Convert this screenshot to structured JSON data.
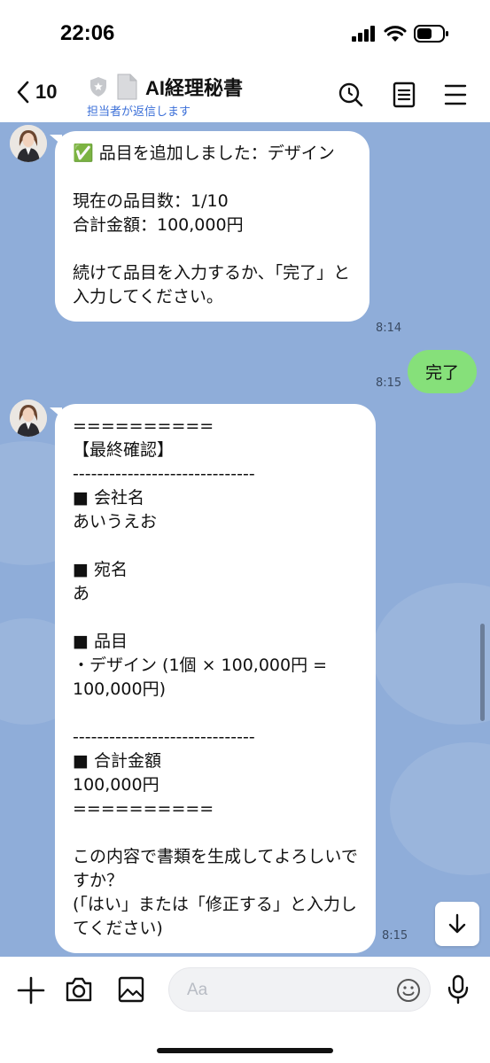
{
  "status_bar": {
    "time": "22:06"
  },
  "header": {
    "back_count": "10",
    "title": "AI経理秘書",
    "subtitle": "担当者が返信します"
  },
  "messages": [
    {
      "sender": "bot",
      "text": "✅ 品目を追加しました：デザイン\n\n現在の品目数：1/10\n合計金額：100,000円\n\n続けて品目を入力するか、「完了」と入力してください。",
      "time": "8:14"
    },
    {
      "sender": "me",
      "text": "完了",
      "time": "8:15"
    },
    {
      "sender": "bot",
      "text": "==========\n【最終確認】\n------------------------------\n■ 会社名\nあいうえお\n\n■ 宛名\nあ\n\n■ 品目\n・デザイン (1個 × 100,000円 = 100,000円)\n\n------------------------------\n■ 合計金額\n100,000円\n==========\n\nこの内容で書類を生成してよろしいですか？\n(「はい」または「修正する」と入力してください)",
      "time": "8:15"
    }
  ],
  "input": {
    "placeholder": "Aa",
    "value": ""
  },
  "icons": {
    "back": "chevron-left-icon",
    "shield": "shield-icon",
    "document": "document-icon",
    "search": "search-icon",
    "notes": "notes-icon",
    "menu": "menu-icon",
    "plus": "plus-icon",
    "camera": "camera-icon",
    "image": "image-icon",
    "emoji": "emoji-icon",
    "mic": "microphone-icon",
    "scroll_down": "arrow-down-icon"
  },
  "colors": {
    "chat_background": "#8fadd9",
    "sent_bubble": "#86e07a",
    "received_bubble": "#ffffff",
    "subtitle_link": "#3b6fd8"
  }
}
